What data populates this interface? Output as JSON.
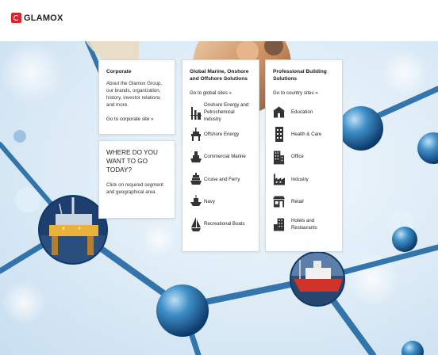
{
  "brand": {
    "name": "GLAMOX",
    "color": "#d6272e"
  },
  "corporate": {
    "title": "Corporate",
    "text": "About the Glamox Group, our brands, organization, history, investor relations and more.",
    "link": "Go to corporate site »"
  },
  "where": {
    "title": "WHERE DO YOU WANT TO GO TODAY?",
    "text": "Click on required segment and geographical area"
  },
  "global": {
    "title": "Global Marine, Onshore and Offshore Solutions",
    "link": "Go to global sites »",
    "items": [
      {
        "label": "Onshore Energy and Petrochemical Industry",
        "icon": "refinery-icon"
      },
      {
        "label": "Offshore Energy",
        "icon": "oil-rig-icon"
      },
      {
        "label": "Commercial Marine",
        "icon": "cargo-ship-icon"
      },
      {
        "label": "Cruise and Ferry",
        "icon": "cruise-ship-icon"
      },
      {
        "label": "Navy",
        "icon": "navy-ship-icon"
      },
      {
        "label": "Recreational Boats",
        "icon": "sailboat-icon"
      }
    ]
  },
  "building": {
    "title": "Professional Building Solutions",
    "link": "Go to country sites »",
    "items": [
      {
        "label": "Education",
        "icon": "school-icon"
      },
      {
        "label": "Health & Care",
        "icon": "hospital-icon"
      },
      {
        "label": "Office",
        "icon": "office-building-icon"
      },
      {
        "label": "Industry",
        "icon": "factory-icon"
      },
      {
        "label": "Retail",
        "icon": "shop-icon"
      },
      {
        "label": "Hotels and Restaurants",
        "icon": "hotel-icon"
      }
    ]
  }
}
